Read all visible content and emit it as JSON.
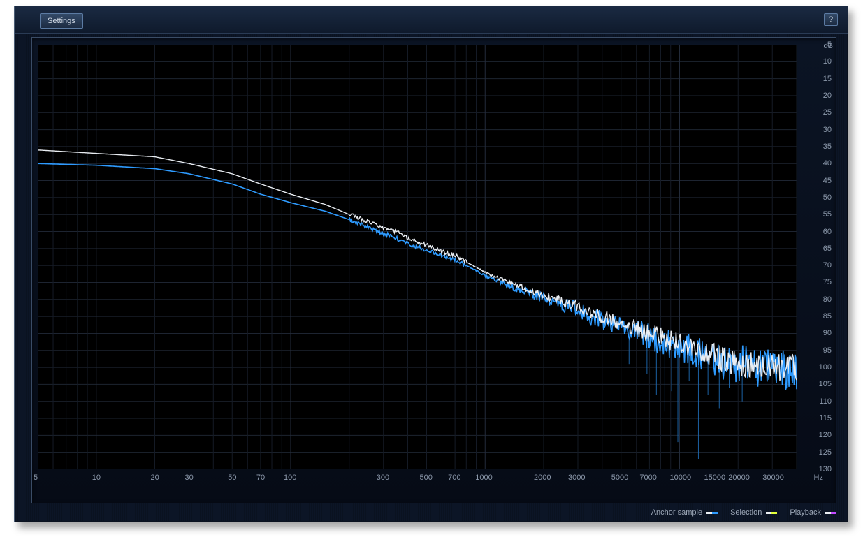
{
  "topbar": {
    "settings_label": "Settings",
    "help_label": "?"
  },
  "legend": {
    "entries": [
      {
        "label": "Anchor sample",
        "colors": [
          "#e9edf2",
          "#2e9bff"
        ]
      },
      {
        "label": "Selection",
        "colors": [
          "#e9edf2",
          "#e4ff3a"
        ]
      },
      {
        "label": "Playback",
        "colors": [
          "#e9edf2",
          "#c44bff"
        ]
      }
    ]
  },
  "axes": {
    "y": {
      "unit": "dB",
      "min": 130,
      "max": 5,
      "ticks": [
        5,
        10,
        15,
        20,
        25,
        30,
        35,
        40,
        45,
        50,
        55,
        60,
        65,
        70,
        75,
        80,
        85,
        90,
        95,
        100,
        105,
        110,
        115,
        120,
        125,
        130
      ]
    },
    "x": {
      "unit": "Hz",
      "min": 5,
      "max": 40000,
      "ticks_labeled": [
        5,
        10,
        20,
        30,
        50,
        70,
        100,
        300,
        500,
        700,
        1000,
        2000,
        3000,
        5000,
        7000,
        10000,
        15000,
        20000,
        30000
      ]
    }
  },
  "chart_data": {
    "type": "line",
    "title": "",
    "xlabel": "Hz",
    "ylabel": "dB",
    "xscale": "log",
    "xlim": [
      5,
      40000
    ],
    "ylim": [
      130,
      5
    ],
    "series": [
      {
        "name": "Anchor sample (white)",
        "color": "#e9edf2",
        "x": [
          5,
          10,
          20,
          30,
          50,
          70,
          100,
          150,
          200,
          280,
          300,
          350,
          400,
          500,
          600,
          700,
          800,
          900,
          1000,
          1200,
          1500,
          1800,
          2200,
          2600,
          3000,
          3500,
          4000,
          5000,
          6000,
          7000,
          8000,
          9000,
          10000,
          12000,
          15000,
          18000,
          22000,
          26000,
          30000,
          35000,
          40000
        ],
        "y": [
          36,
          37,
          38,
          40,
          43,
          46,
          49,
          52,
          55,
          58,
          59,
          60,
          62,
          64,
          66,
          67,
          69,
          70.5,
          72,
          74,
          76,
          78,
          79.5,
          81,
          82,
          84,
          85,
          87,
          88.5,
          90,
          91,
          92,
          93,
          95,
          96.5,
          98,
          99,
          99.5,
          100,
          100,
          100
        ]
      },
      {
        "name": "Anchor sample (blue)",
        "color": "#2e9bff",
        "x": [
          5,
          10,
          20,
          30,
          50,
          70,
          100,
          150,
          200,
          280,
          300,
          350,
          400,
          500,
          600,
          700,
          800,
          900,
          1000,
          1200,
          1500,
          1800,
          2200,
          2600,
          3000,
          3500,
          4000,
          5000,
          6000,
          7000,
          8000,
          9000,
          10000,
          12000,
          15000,
          18000,
          22000,
          26000,
          30000,
          35000,
          40000
        ],
        "y": [
          40,
          40.5,
          41.5,
          43,
          46,
          49,
          51.5,
          54,
          56.5,
          60,
          60.5,
          62,
          63.5,
          65.5,
          67,
          68.5,
          70,
          71.5,
          73,
          75,
          77,
          79,
          80.5,
          82,
          83,
          85,
          86,
          88,
          89.5,
          91,
          92,
          93,
          94,
          95.5,
          97,
          98.5,
          99.5,
          100,
          100.5,
          101,
          101
        ]
      }
    ],
    "spikes": {
      "color": "#1e6bb5",
      "approx_db_floor": 130,
      "note": "High-frequency downward spikes on the blue trace between ~5 kHz and ~30 kHz reaching roughly 105–130 dB",
      "samples": [
        {
          "hz": 5500,
          "db": 99
        },
        {
          "hz": 6800,
          "db": 102
        },
        {
          "hz": 7600,
          "db": 108
        },
        {
          "hz": 8400,
          "db": 113
        },
        {
          "hz": 9100,
          "db": 107
        },
        {
          "hz": 9800,
          "db": 122
        },
        {
          "hz": 11200,
          "db": 104
        },
        {
          "hz": 12500,
          "db": 127
        },
        {
          "hz": 14000,
          "db": 108
        },
        {
          "hz": 16000,
          "db": 112
        },
        {
          "hz": 18000,
          "db": 106
        },
        {
          "hz": 21000,
          "db": 110
        },
        {
          "hz": 25000,
          "db": 104
        }
      ]
    }
  }
}
